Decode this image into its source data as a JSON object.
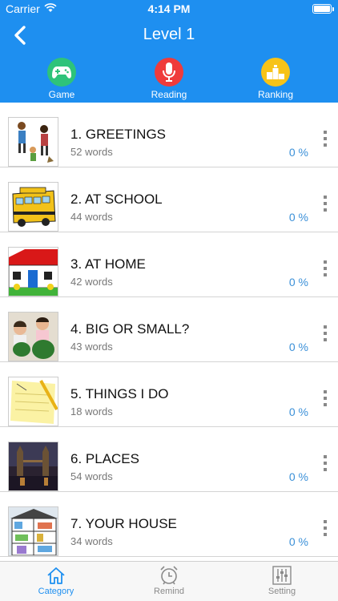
{
  "status": {
    "carrier": "Carrier",
    "time": "4:14 PM",
    "battery_level": 1.0
  },
  "nav": {
    "title": "Level 1"
  },
  "modes": [
    {
      "label": "Game",
      "icon": "gamepad-icon",
      "color": "#2ec37a"
    },
    {
      "label": "Reading",
      "icon": "microphone-icon",
      "color": "#ef3b3b"
    },
    {
      "label": "Ranking",
      "icon": "podium-icon",
      "color": "#f7c318"
    }
  ],
  "lessons": [
    {
      "title": "1. GREETINGS",
      "words": "52 words",
      "progress": "0 %"
    },
    {
      "title": "2. AT SCHOOL",
      "words": "44 words",
      "progress": "0 %"
    },
    {
      "title": "3. AT HOME",
      "words": "42 words",
      "progress": "0 %"
    },
    {
      "title": "4. BIG OR SMALL?",
      "words": "43 words",
      "progress": "0 %"
    },
    {
      "title": "5. THINGS I DO",
      "words": "18 words",
      "progress": "0 %"
    },
    {
      "title": "6. PLACES",
      "words": "54 words",
      "progress": "0 %"
    },
    {
      "title": "7. YOUR HOUSE",
      "words": "34 words",
      "progress": "0 %"
    }
  ],
  "tabs": [
    {
      "label": "Category",
      "icon": "home-icon",
      "active": true
    },
    {
      "label": "Remind",
      "icon": "alarm-clock-icon",
      "active": false
    },
    {
      "label": "Setting",
      "icon": "sliders-icon",
      "active": false
    }
  ],
  "colors": {
    "header": "#1e8ff0",
    "active_tab": "#1e8ff0",
    "inactive_tab": "#8a8a8a",
    "progress": "#3b90d8"
  }
}
